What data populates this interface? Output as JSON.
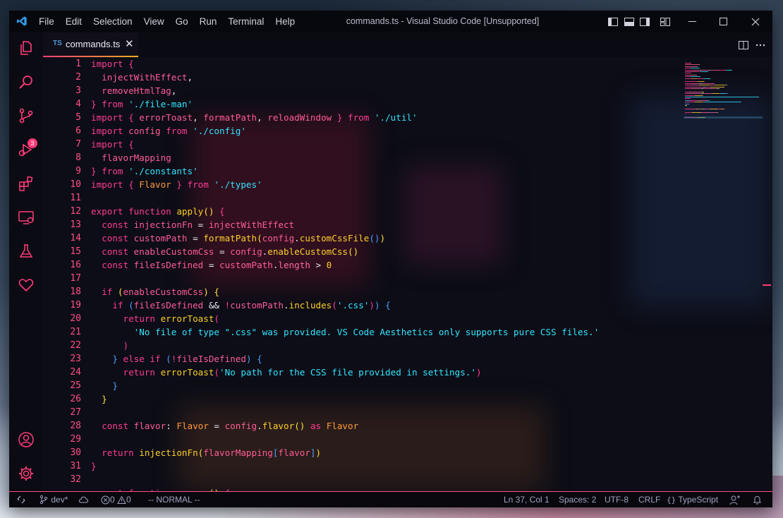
{
  "window": {
    "title": "commands.ts - Visual Studio Code [Unsupported]"
  },
  "menu": [
    "File",
    "Edit",
    "Selection",
    "View",
    "Go",
    "Run",
    "Terminal",
    "Help"
  ],
  "activity_bar": {
    "items": [
      "explorer-icon",
      "search-icon",
      "source-control-icon",
      "run-debug-icon",
      "extensions-icon",
      "remote-explorer-icon",
      "testing-icon",
      "heart-icon"
    ],
    "source_control_badge": "3",
    "bottom": [
      "account-icon",
      "settings-gear-icon"
    ]
  },
  "tab": {
    "lang_badge": "TS",
    "filename": "commands.ts",
    "close_glyph": "✕"
  },
  "code": {
    "line_numbers": [
      "1",
      "2",
      "3",
      "4",
      "5",
      "6",
      "7",
      "8",
      "9",
      "10",
      "11",
      "12",
      "13",
      "14",
      "15",
      "16",
      "17",
      "18",
      "19",
      "20",
      "21",
      "22",
      "23",
      "24",
      "25",
      "26",
      "27",
      "28",
      "29",
      "30",
      "31",
      "32"
    ],
    "lines": [
      [
        {
          "t": "import ",
          "c": "k"
        },
        {
          "t": "{",
          "c": "b1"
        }
      ],
      [
        {
          "t": "  injectWithEffect",
          "c": "v"
        },
        {
          "t": ",",
          "c": "o"
        }
      ],
      [
        {
          "t": "  removeHtmlTag",
          "c": "v"
        },
        {
          "t": ",",
          "c": "o"
        }
      ],
      [
        {
          "t": "} ",
          "c": "b1"
        },
        {
          "t": "from ",
          "c": "k"
        },
        {
          "t": "'./file-man'",
          "c": "s"
        }
      ],
      [
        {
          "t": "import ",
          "c": "k"
        },
        {
          "t": "{ ",
          "c": "b1"
        },
        {
          "t": "errorToast",
          "c": "v"
        },
        {
          "t": ", ",
          "c": "o"
        },
        {
          "t": "formatPath",
          "c": "v"
        },
        {
          "t": ", ",
          "c": "o"
        },
        {
          "t": "reloadWindow",
          "c": "v"
        },
        {
          "t": " } ",
          "c": "b1"
        },
        {
          "t": "from ",
          "c": "k"
        },
        {
          "t": "'./util'",
          "c": "s"
        }
      ],
      [
        {
          "t": "import ",
          "c": "k"
        },
        {
          "t": "config ",
          "c": "v"
        },
        {
          "t": "from ",
          "c": "k"
        },
        {
          "t": "'./config'",
          "c": "s"
        }
      ],
      [
        {
          "t": "import ",
          "c": "k"
        },
        {
          "t": "{",
          "c": "b1"
        }
      ],
      [
        {
          "t": "  flavorMapping",
          "c": "v"
        }
      ],
      [
        {
          "t": "} ",
          "c": "b1"
        },
        {
          "t": "from ",
          "c": "k"
        },
        {
          "t": "'./constants'",
          "c": "s"
        }
      ],
      [
        {
          "t": "import ",
          "c": "k"
        },
        {
          "t": "{ ",
          "c": "b1"
        },
        {
          "t": "Flavor",
          "c": "t"
        },
        {
          "t": " } ",
          "c": "b1"
        },
        {
          "t": "from ",
          "c": "k"
        },
        {
          "t": "'./types'",
          "c": "s"
        }
      ],
      [],
      [
        {
          "t": "export ",
          "c": "k"
        },
        {
          "t": "function ",
          "c": "k"
        },
        {
          "t": "apply",
          "c": "f"
        },
        {
          "t": "() ",
          "c": "b2"
        },
        {
          "t": "{",
          "c": "b1"
        }
      ],
      [
        {
          "t": "  const ",
          "c": "k"
        },
        {
          "t": "injectionFn",
          "c": "v"
        },
        {
          "t": " = ",
          "c": "o"
        },
        {
          "t": "injectWithEffect",
          "c": "v"
        }
      ],
      [
        {
          "t": "  const ",
          "c": "k"
        },
        {
          "t": "customPath",
          "c": "v"
        },
        {
          "t": " = ",
          "c": "o"
        },
        {
          "t": "formatPath",
          "c": "f"
        },
        {
          "t": "(",
          "c": "b2"
        },
        {
          "t": "config",
          "c": "v"
        },
        {
          "t": ".",
          "c": "o"
        },
        {
          "t": "customCssFile",
          "c": "f"
        },
        {
          "t": "()",
          "c": "b3"
        },
        {
          "t": ")",
          "c": "b2"
        }
      ],
      [
        {
          "t": "  const ",
          "c": "k"
        },
        {
          "t": "enableCustomCss",
          "c": "v"
        },
        {
          "t": " = ",
          "c": "o"
        },
        {
          "t": "config",
          "c": "v"
        },
        {
          "t": ".",
          "c": "o"
        },
        {
          "t": "enableCustomCss",
          "c": "f"
        },
        {
          "t": "()",
          "c": "b2"
        }
      ],
      [
        {
          "t": "  const ",
          "c": "k"
        },
        {
          "t": "fileIsDefined",
          "c": "v"
        },
        {
          "t": " = ",
          "c": "o"
        },
        {
          "t": "customPath",
          "c": "v"
        },
        {
          "t": ".",
          "c": "o"
        },
        {
          "t": "length",
          "c": "p"
        },
        {
          "t": " > ",
          "c": "o"
        },
        {
          "t": "0",
          "c": "c"
        }
      ],
      [],
      [
        {
          "t": "  if ",
          "c": "k"
        },
        {
          "t": "(",
          "c": "b2"
        },
        {
          "t": "enableCustomCss",
          "c": "v"
        },
        {
          "t": ") ",
          "c": "b2"
        },
        {
          "t": "{",
          "c": "b2"
        }
      ],
      [
        {
          "t": "    if ",
          "c": "k"
        },
        {
          "t": "(",
          "c": "b3"
        },
        {
          "t": "fileIsDefined",
          "c": "v"
        },
        {
          "t": " && ",
          "c": "o"
        },
        {
          "t": "!",
          "c": "k"
        },
        {
          "t": "customPath",
          "c": "v"
        },
        {
          "t": ".",
          "c": "o"
        },
        {
          "t": "includes",
          "c": "f"
        },
        {
          "t": "(",
          "c": "b1"
        },
        {
          "t": "'.css'",
          "c": "s"
        },
        {
          "t": ")",
          "c": "b1"
        },
        {
          "t": ") ",
          "c": "b3"
        },
        {
          "t": "{",
          "c": "b3"
        }
      ],
      [
        {
          "t": "      return ",
          "c": "k"
        },
        {
          "t": "errorToast",
          "c": "f"
        },
        {
          "t": "(",
          "c": "b1"
        }
      ],
      [
        {
          "t": "        'No file of type \".css\" was provided. VS Code Aesthetics only supports pure CSS files.'",
          "c": "s"
        }
      ],
      [
        {
          "t": "      )",
          "c": "b1"
        }
      ],
      [
        {
          "t": "    } ",
          "c": "b3"
        },
        {
          "t": "else ",
          "c": "k"
        },
        {
          "t": "if ",
          "c": "k"
        },
        {
          "t": "(",
          "c": "b3"
        },
        {
          "t": "!",
          "c": "k"
        },
        {
          "t": "fileIsDefined",
          "c": "v"
        },
        {
          "t": ") ",
          "c": "b3"
        },
        {
          "t": "{",
          "c": "b3"
        }
      ],
      [
        {
          "t": "      return ",
          "c": "k"
        },
        {
          "t": "errorToast",
          "c": "f"
        },
        {
          "t": "(",
          "c": "b1"
        },
        {
          "t": "'No path for the CSS file provided in settings.'",
          "c": "s"
        },
        {
          "t": ")",
          "c": "b1"
        }
      ],
      [
        {
          "t": "    }",
          "c": "b3"
        }
      ],
      [
        {
          "t": "  }",
          "c": "b2"
        }
      ],
      [],
      [
        {
          "t": "  const ",
          "c": "k"
        },
        {
          "t": "flavor",
          "c": "v"
        },
        {
          "t": ": ",
          "c": "o"
        },
        {
          "t": "Flavor",
          "c": "t"
        },
        {
          "t": " = ",
          "c": "o"
        },
        {
          "t": "config",
          "c": "v"
        },
        {
          "t": ".",
          "c": "o"
        },
        {
          "t": "flavor",
          "c": "f"
        },
        {
          "t": "() ",
          "c": "b2"
        },
        {
          "t": "as ",
          "c": "k"
        },
        {
          "t": "Flavor",
          "c": "t"
        }
      ],
      [],
      [
        {
          "t": "  return ",
          "c": "k"
        },
        {
          "t": "injectionFn",
          "c": "f"
        },
        {
          "t": "(",
          "c": "b2"
        },
        {
          "t": "flavorMapping",
          "c": "v"
        },
        {
          "t": "[",
          "c": "b3"
        },
        {
          "t": "flavor",
          "c": "v"
        },
        {
          "t": "]",
          "c": "b3"
        },
        {
          "t": ")",
          "c": "b2"
        }
      ],
      [
        {
          "t": "}",
          "c": "b1"
        }
      ],
      [],
      [
        {
          "t": "export ",
          "c": "k"
        },
        {
          "t": "function ",
          "c": "k"
        },
        {
          "t": "remove",
          "c": "f"
        },
        {
          "t": "() ",
          "c": "b2"
        },
        {
          "t": "{",
          "c": "b1"
        }
      ]
    ]
  },
  "status_bar": {
    "branch": "dev*",
    "errors": "0",
    "warnings": "0",
    "mode": "-- NORMAL --",
    "cursor": "Ln 37, Col 1",
    "indent": "Spaces: 2",
    "encoding": "UTF-8",
    "eol": "CRLF",
    "language": "TypeScript"
  },
  "colors": {
    "accent_pink": "#ff3c78",
    "keyword": "#ff3c94",
    "function": "#ffd02a",
    "string": "#34e4ff",
    "line_number": "#ff4f86"
  }
}
